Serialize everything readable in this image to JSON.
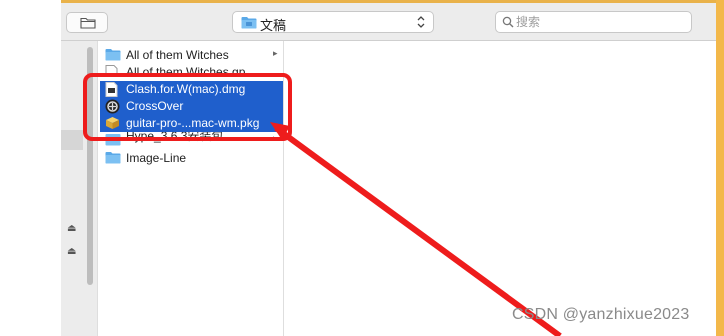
{
  "toolbar": {
    "new_folder_icon": "folder-outline-icon",
    "path_select": {
      "value": "文稿",
      "icon": "folder-icon"
    },
    "search": {
      "placeholder": "搜索",
      "icon": "magnifier-icon"
    }
  },
  "file_list": {
    "items": [
      {
        "label": "All of them Witches",
        "icon": "folder-icon",
        "selected": false,
        "has_children": true
      },
      {
        "label": "All of them Witches.gp",
        "icon": "document-icon",
        "selected": false,
        "has_children": false
      },
      {
        "label": "Clash.for.W(mac).dmg",
        "icon": "disk-image-icon",
        "selected": true,
        "has_children": false
      },
      {
        "label": "CrossOver",
        "icon": "crossover-app-icon",
        "selected": true,
        "has_children": false
      },
      {
        "label": "guitar-pro-...mac-wm.pkg",
        "icon": "package-icon",
        "selected": true,
        "has_children": false
      },
      {
        "label": "Hype_3.6.3安装包",
        "icon": "folder-icon",
        "selected": false,
        "has_children": true
      },
      {
        "label": "Image-Line",
        "icon": "folder-icon",
        "selected": false,
        "has_children": false
      }
    ],
    "chevron": "▸"
  },
  "sidebar": {
    "eject_glyph": "⏏"
  },
  "annotation": {
    "box_color": "#ee1c1c",
    "arrow_color": "#ee1c1c"
  },
  "watermark": "CSDN @yanzhixue2023",
  "colors": {
    "selection": "#1f5fcc",
    "toolbar": "#ececec"
  }
}
